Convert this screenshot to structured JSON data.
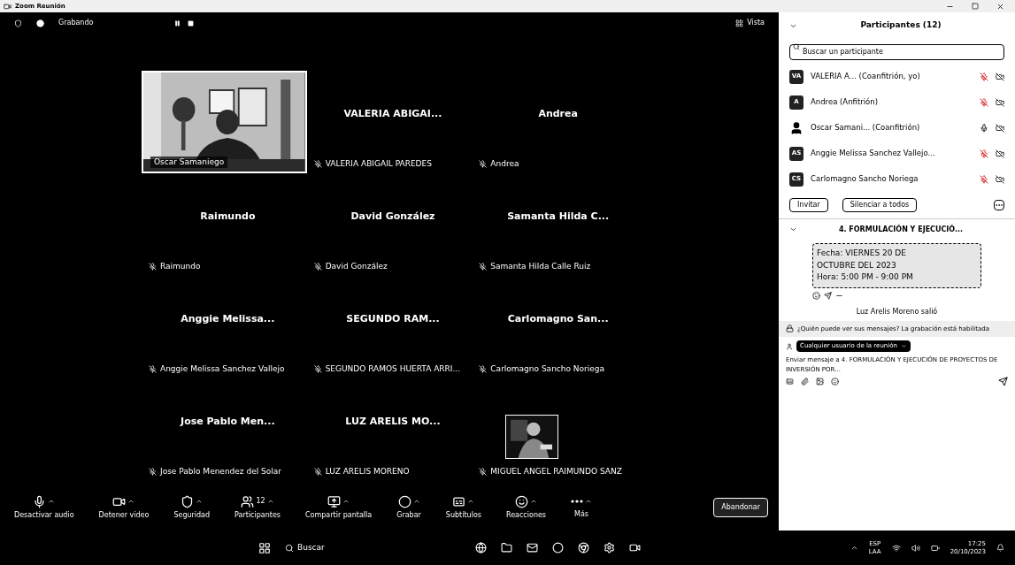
{
  "window": {
    "title": "Zoom Reunión"
  },
  "meeting": {
    "recording_label": "Grabando",
    "view_label": "Vista",
    "tiles": [
      {
        "kind": "video",
        "label": "Oscar Samaniego"
      },
      {
        "kind": "name",
        "name": "VALERIA ABIGAI...",
        "label": "VALERIA ABIGAIL PAREDES"
      },
      {
        "kind": "name",
        "name": "Andrea",
        "label": "Andrea"
      },
      {
        "kind": "name",
        "name": "Raimundo",
        "label": "Raimundo"
      },
      {
        "kind": "name",
        "name": "David González",
        "label": "David González"
      },
      {
        "kind": "name",
        "name": "Samanta Hilda C...",
        "label": "Samanta Hilda Calle Ruiz"
      },
      {
        "kind": "name",
        "name": "Anggie Melissa...",
        "label": "Anggie Melissa Sanchez Vallejo"
      },
      {
        "kind": "name",
        "name": "SEGUNDO RAM...",
        "label": "SEGUNDO RAMOS HUERTA ARRI..."
      },
      {
        "kind": "name",
        "name": "Carlomagno San...",
        "label": "Carlomagno Sancho Noriega"
      },
      {
        "kind": "name",
        "name": "Jose Pablo Men...",
        "label": "Jose Pablo Menendez del Solar"
      },
      {
        "kind": "name",
        "name": "LUZ ARELIS MO...",
        "label": "LUZ ARELIS MORENO"
      },
      {
        "label": "MIGUEL ANGEL RAIMUNDO SANZ"
      }
    ]
  },
  "toolbar": {
    "items": [
      {
        "kind": "mic",
        "label": "Desactivar audio"
      },
      {
        "kind": "video",
        "label": "Detener video"
      },
      {
        "kind": "shield",
        "label": "Seguridad"
      },
      {
        "kind": "users",
        "label": "Participantes",
        "count": "12"
      },
      {
        "kind": "share",
        "label": "Compartir pantalla"
      },
      {
        "kind": "record",
        "label": "Grabar"
      },
      {
        "kind": "captions",
        "label": "Subtítulos"
      },
      {
        "kind": "smile",
        "label": "Reacciones"
      },
      {
        "kind": "more",
        "label": "Más"
      }
    ],
    "leave": "Abandonar"
  },
  "participants": {
    "title": "Participantes (12)",
    "search_placeholder": "Buscar un participante",
    "items": [
      {
        "initials": "VA",
        "name": "VALERIA A... (Coanfitrión, yo)",
        "muted": true
      },
      {
        "initials": "A",
        "name": "Andrea (Anfitrión)",
        "muted": true
      },
      {
        "name": "Oscar Samani... (Coanfitrión)",
        "muted": false
      },
      {
        "initials": "AS",
        "name": "Anggie Melissa Sanchez Vallejo...",
        "muted": true
      },
      {
        "initials": "CS",
        "name": "Carlomagno Sancho Noriega",
        "muted": true
      }
    ],
    "buttons": [
      "Invitar",
      "Silenciar a todos"
    ]
  },
  "chat": {
    "title": "4. FORMULACIÓN Y EJECUCIÓ...",
    "message_lines": [
      "Fecha: VIERNES 20 DE",
      "OCTUBRE DEL 2023",
      "Hora:  5:00 PM - 9:00 PM"
    ],
    "event": "Luz Arelis Moreno salió",
    "notice": "¿Quién puede ver sus mensajes? La grabación está habilitada",
    "recipient": "Cualquier usuario de la reunión",
    "placeholder": "Enviar mensaje a 4. FORMULACIÓN Y EJECUCIÓN DE PROYECTOS DE INVERSIÓN POR..."
  },
  "taskbar": {
    "search": "Buscar",
    "language": [
      "ESP",
      "LAA"
    ],
    "time": "17:25",
    "date": "20/10/2023"
  }
}
